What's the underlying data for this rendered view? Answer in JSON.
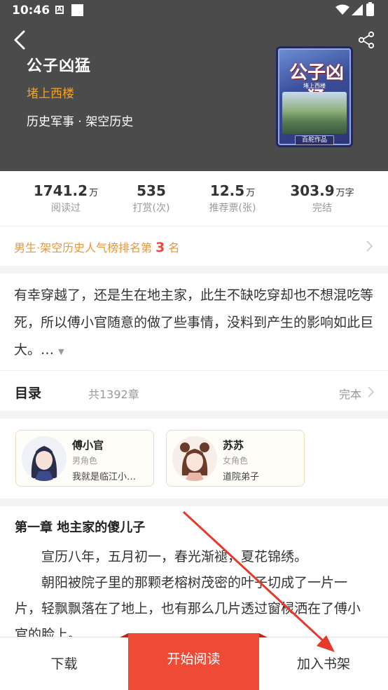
{
  "status_bar": {
    "time": "10:46",
    "notif_icon": "A"
  },
  "book": {
    "title": "公子凶猛",
    "author": "堵上西楼",
    "category": "历史军事 · 架空历史",
    "cover": {
      "title": "公子凶猛",
      "author": "堵上西楼",
      "badge": "百舵作品"
    }
  },
  "stats": [
    {
      "value": "1741.2",
      "unit": "万",
      "label": "阅读过"
    },
    {
      "value": "535",
      "unit": "",
      "label": "打赏(次)"
    },
    {
      "value": "12.5",
      "unit": "万",
      "label": "推荐票(张)"
    },
    {
      "value": "303.9",
      "unit": "万字",
      "label": "完结"
    }
  ],
  "rank": {
    "prefix": "男生·架空历史人气榜排名第",
    "rank": "3",
    "suffix": "名"
  },
  "description": "有幸穿越了，还是生在地主家，此生不缺吃穿却也不想混吃等死，所以傅小官随意的做了些事情，没料到产生的影响如此巨大。…",
  "toc": {
    "title": "目录",
    "count": "共1392章",
    "status": "完本"
  },
  "characters": [
    {
      "name": "傅小官",
      "role": "男角色",
      "desc": "我就是临江小…"
    },
    {
      "name": "苏苏",
      "role": "女角色",
      "desc": "道院弟子"
    }
  ],
  "chapter": {
    "title": "第一章 地主家的傻儿子",
    "paragraphs": [
      "宣历八年，五月初一，春光渐褪，夏花锦绣。",
      "朝阳被院子里的那颗老榕树茂密的叶子切成了一片一片，轻飘飘落在了地上，也有那么几片透过窗棂洒在了傅小官的脸上。"
    ]
  },
  "bottom_bar": {
    "download": "下载",
    "read": "开始阅读",
    "shelf": "加入书架"
  },
  "colors": {
    "header_bg": "#4b4b4b",
    "author": "#f0a22f",
    "rank": "#e8963a",
    "rank_num": "#e84b3a",
    "read_button": "#ef4a35"
  },
  "icons": [
    "back-arrow-icon",
    "share-icon",
    "chevron-right-icon",
    "wifi-icon",
    "signal-icon",
    "battery-icon"
  ]
}
